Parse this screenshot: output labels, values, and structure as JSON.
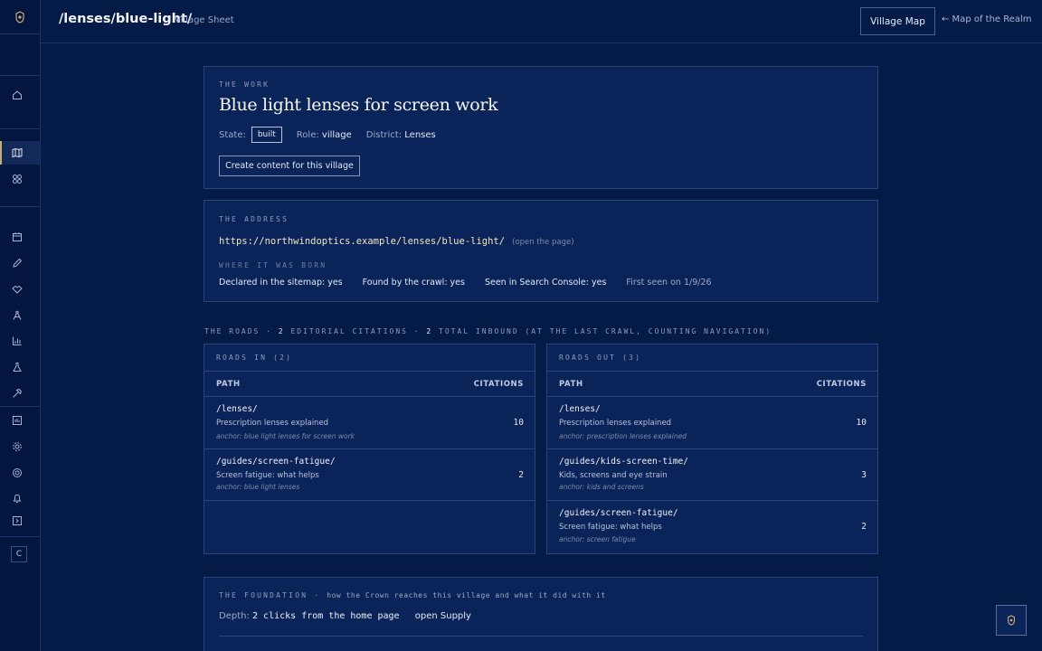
{
  "header": {
    "path_title": "/lenses/blue-light/",
    "subtitle": "Village Sheet",
    "village_map_button": "Village Map",
    "back_link": "← Map of the Realm"
  },
  "sidebar": {
    "user_initial": "C"
  },
  "work": {
    "eyebrow": "THE WORK",
    "title": "Blue light lenses for screen work",
    "state_label": "State:",
    "state_value": "built",
    "role_label": "Role:",
    "role_value": "village",
    "district_label": "District:",
    "district_value": "Lenses",
    "create_button": "Create content for this village"
  },
  "address": {
    "eyebrow": "THE ADDRESS",
    "url": "https://northwindoptics.example/lenses/blue-light/",
    "open_link": "(open the page)",
    "born_eyebrow": "WHERE IT WAS BORN",
    "sitemap": "Declared in the sitemap: yes",
    "crawl": "Found by the crawl: yes",
    "search_console": "Seen in Search Console: yes",
    "first_seen": "First seen on 1/9/26"
  },
  "roads": {
    "caption_prefix": "THE ROADS · ",
    "editorial_count": "2",
    "editorial_label": " EDITORIAL CITATIONS · ",
    "total_count": "2",
    "total_label": " TOTAL INBOUND (AT THE LAST CRAWL, COUNTING NAVIGATION)",
    "in": {
      "title": "ROADS IN (2)",
      "col_path": "PATH",
      "col_citations": "CITATIONS",
      "rows": [
        {
          "path": "/lenses/",
          "title": "Prescription lenses explained",
          "anchor": "anchor: blue light lenses for screen work",
          "citations": "10"
        },
        {
          "path": "/guides/screen-fatigue/",
          "title": "Screen fatigue: what helps",
          "anchor": "anchor: blue light lenses",
          "citations": "2"
        }
      ]
    },
    "out": {
      "title": "ROADS OUT (3)",
      "col_path": "PATH",
      "col_citations": "CITATIONS",
      "rows": [
        {
          "path": "/lenses/",
          "title": "Prescription lenses explained",
          "anchor": "anchor: prescription lenses explained",
          "citations": "10"
        },
        {
          "path": "/guides/kids-screen-time/",
          "title": "Kids, screens and eye strain",
          "anchor": "anchor: kids and screens",
          "citations": "3"
        },
        {
          "path": "/guides/screen-fatigue/",
          "title": "Screen fatigue: what helps",
          "anchor": "anchor: screen fatigue",
          "citations": "2"
        }
      ]
    }
  },
  "foundation": {
    "eyebrow": "THE FOUNDATION",
    "separator": " · ",
    "description": "how the Crown reaches this village and what it did with it",
    "depth_label": "Depth:",
    "depth_value": "2 clicks from the home page",
    "supply_link": "open Supply"
  }
}
